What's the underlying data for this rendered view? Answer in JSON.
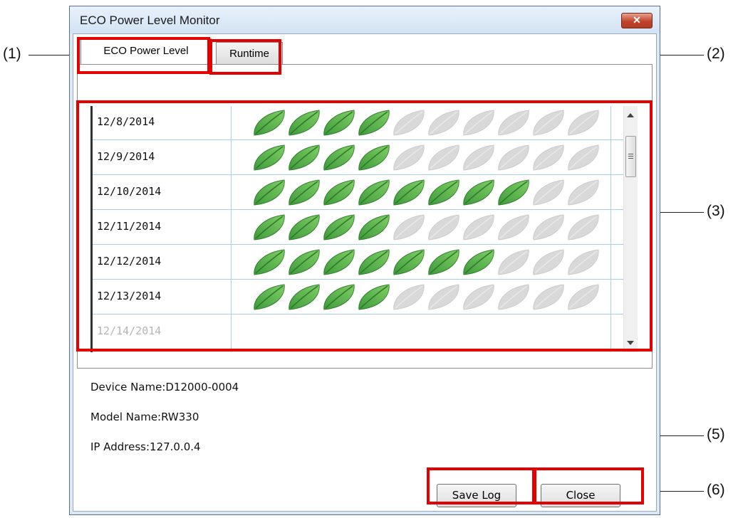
{
  "window": {
    "title": "ECO Power Level Monitor",
    "close_glyph": "✕"
  },
  "tabs": [
    {
      "label": "ECO Power Level"
    },
    {
      "label": "Runtime"
    }
  ],
  "leaves_total": 10,
  "colors": {
    "leaf_active": "#4caf50",
    "leaf_inactive": "#d9d9d9",
    "highlight": "#e30000"
  },
  "grid_rows": [
    {
      "date": "12/8/2014",
      "level": 4
    },
    {
      "date": "12/9/2014",
      "level": 4
    },
    {
      "date": "12/10/2014",
      "level": 8
    },
    {
      "date": "12/11/2014",
      "level": 4
    },
    {
      "date": "12/12/2014",
      "level": 7
    },
    {
      "date": "12/13/2014",
      "level": 4
    },
    {
      "date": "12/14/2014",
      "level": null
    }
  ],
  "info": {
    "device_name": "Device Name:D12000-0004",
    "model_name": "Model Name:RW330",
    "ip_address": "IP Address:127.0.0.4"
  },
  "buttons": {
    "save_log": "Save Log",
    "close": "Close"
  },
  "callouts": {
    "c1": "(1)",
    "c2": "(2)",
    "c3": "(3)",
    "c5": "(5)",
    "c6": "(6)"
  }
}
